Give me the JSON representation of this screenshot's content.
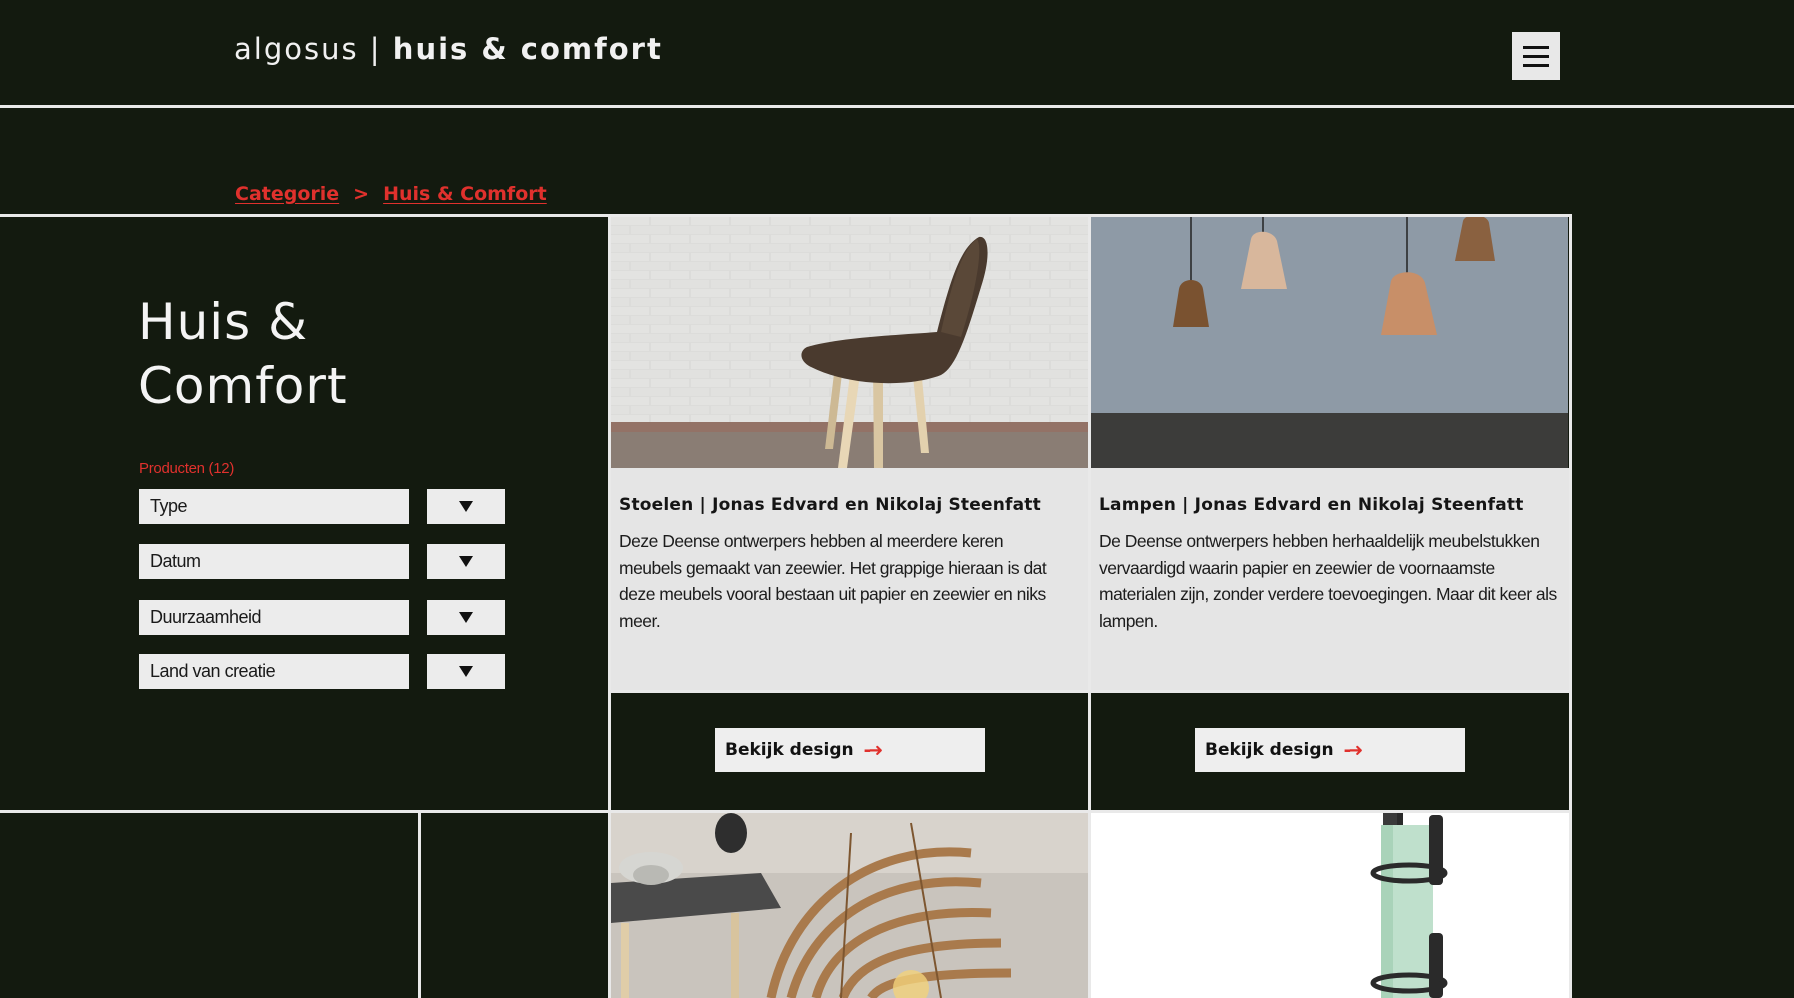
{
  "header": {
    "brand_light": "algosus",
    "brand_sep": "|",
    "brand_bold": "huis & comfort",
    "menu_icon": "hamburger-icon"
  },
  "breadcrumb": {
    "items": [
      "Categorie",
      "Huis & Comfort"
    ],
    "separator": ">"
  },
  "sidebar": {
    "title_line1": "Huis &",
    "title_line2": "Comfort",
    "count_label": "Producten (12)",
    "filters": [
      {
        "label": "Type"
      },
      {
        "label": "Datum"
      },
      {
        "label": "Duurzaamheid"
      },
      {
        "label": "Land van creatie"
      }
    ]
  },
  "cards": [
    {
      "title": "Stoelen | Jonas Edvard en Nikolaj Steenfatt",
      "description": "Deze Deense ontwerpers hebben al meerdere keren meubels gemaakt van zeewier. Het grappige hieraan is dat deze meubels vooral bestaan uit papier en zeewier en niks meer.",
      "button": "Bekijk design"
    },
    {
      "title": "Lampen | Jonas Edvard en Nikolaj Steenfatt",
      "description": "De Deense ontwerpers hebben herhaaldelijk meubelstukken vervaardigd waarin papier en zeewier de voornaamste materialen zijn, zonder verdere toevoegingen. Maar dit keer als lampen.",
      "button": "Bekijk design"
    }
  ],
  "colors": {
    "background": "#131a0f",
    "accent": "#e0312d",
    "panel": "#e5e5e5"
  }
}
